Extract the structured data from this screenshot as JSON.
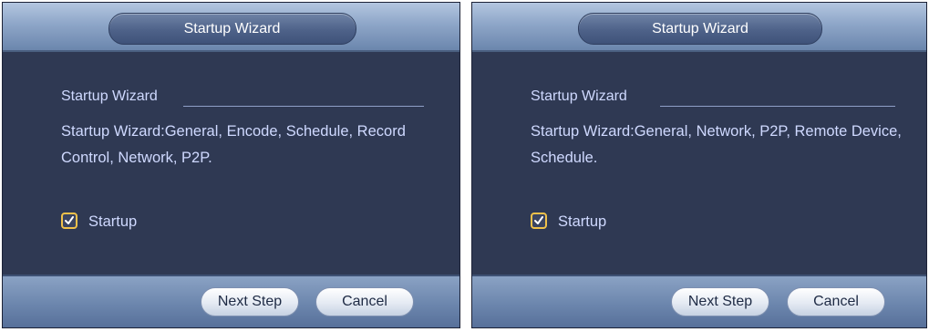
{
  "dialogs": [
    {
      "title": "Startup Wizard",
      "section_heading": "Startup Wizard",
      "description": "Startup Wizard:General, Encode, Schedule, Record Control, Network, P2P.",
      "checkbox": {
        "label": "Startup",
        "checked": true
      },
      "buttons": {
        "next": "Next Step",
        "cancel": "Cancel"
      }
    },
    {
      "title": "Startup Wizard",
      "section_heading": "Startup Wizard",
      "description": "Startup Wizard:General, Network, P2P, Remote Device, Schedule.",
      "checkbox": {
        "label": "Startup",
        "checked": true
      },
      "buttons": {
        "next": "Next Step",
        "cancel": "Cancel"
      }
    }
  ],
  "colors": {
    "panel_background": "#2f3953",
    "text": "#cfd9ff",
    "checkbox_accent": "#f0c14a",
    "title_bar": "#8ea6c8"
  },
  "icons": {
    "checkbox_mark": "check-icon"
  }
}
